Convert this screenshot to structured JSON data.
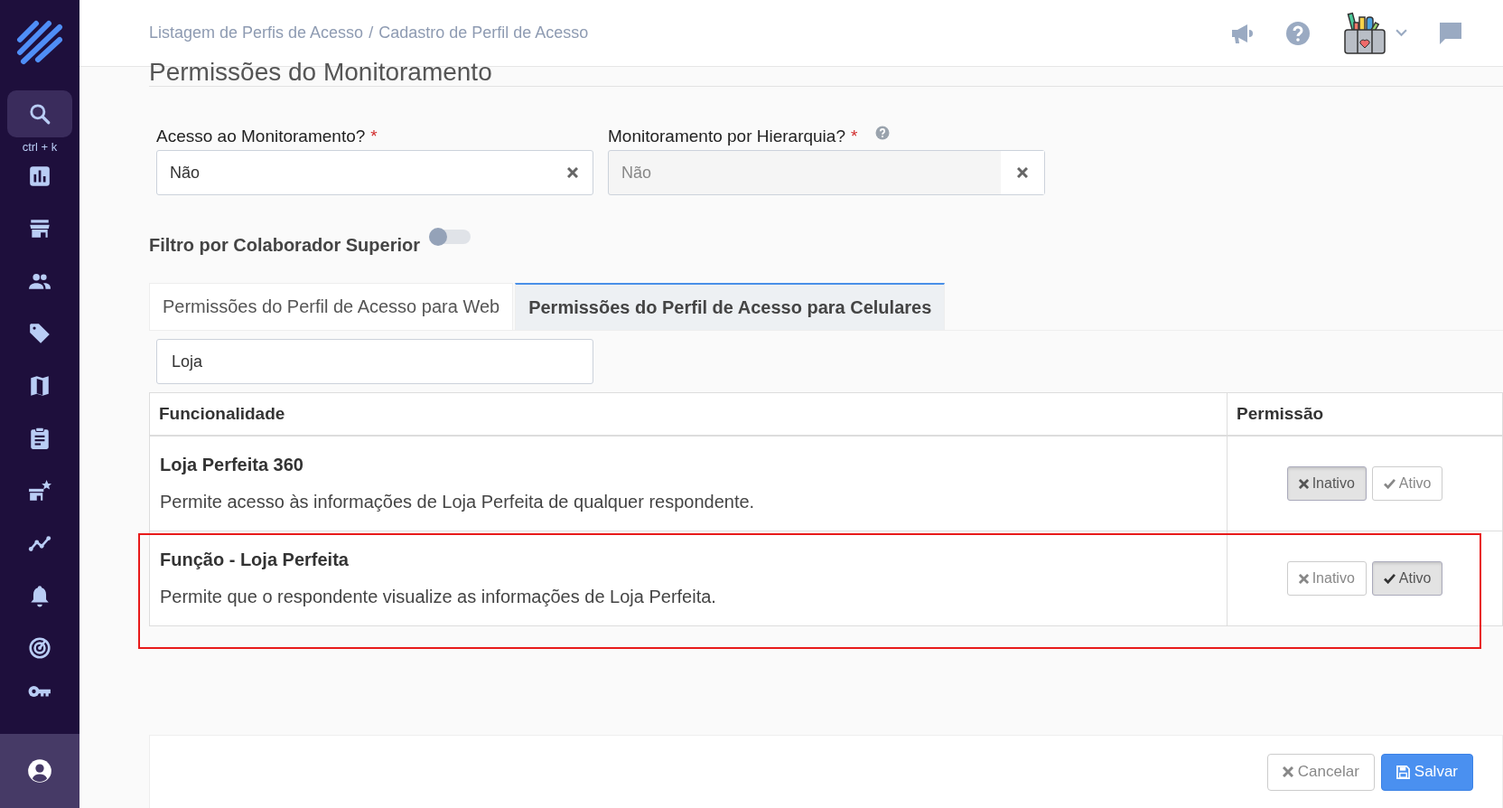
{
  "sidebar": {
    "search_shortcut": "ctrl + k"
  },
  "header": {
    "breadcrumb": [
      {
        "label": "Listagem de Perfis de Acesso"
      },
      {
        "label": "Cadastro de Perfil de Acesso"
      }
    ],
    "separator": "/"
  },
  "section_title": "Permissões do Monitoramento",
  "fields": [
    {
      "label": "Acesso ao Monitoramento?",
      "required_mark": "*",
      "help": false,
      "value": "Não",
      "disabled": false
    },
    {
      "label": "Monitoramento por Hierarquia?",
      "required_mark": "*",
      "help": true,
      "value": "Não",
      "disabled": true
    }
  ],
  "filter_toggle": {
    "label": "Filtro por Colaborador Superior",
    "on": false
  },
  "tabs": [
    {
      "label": "Permissões do Perfil de Acesso para Web",
      "selected": false
    },
    {
      "label": "Permissões do Perfil de Acesso para Celulares",
      "selected": true
    }
  ],
  "search": {
    "value": "Loja"
  },
  "table": {
    "columns": [
      "Funcionalidade",
      "Permissão"
    ],
    "rows": [
      {
        "title": "Loja Perfeita 360",
        "description": "Permite acesso às informações de Loja Perfeita de qualquer respondente.",
        "highlighted": false,
        "options": [
          {
            "kind": "off",
            "label": "Inativo",
            "selected": true
          },
          {
            "kind": "on",
            "label": "Ativo",
            "selected": false
          }
        ]
      },
      {
        "title": "Função - Loja Perfeita",
        "description": "Permite que o respondente visualize as informações de Loja Perfeita.",
        "highlighted": true,
        "options": [
          {
            "kind": "off",
            "label": "Inativo",
            "selected": false
          },
          {
            "kind": "on",
            "label": "Ativo",
            "selected": true
          }
        ]
      }
    ]
  },
  "footer": {
    "buttons": [
      {
        "kind": "cancel",
        "label": "Cancelar"
      },
      {
        "kind": "save",
        "label": "Salvar"
      }
    ]
  }
}
